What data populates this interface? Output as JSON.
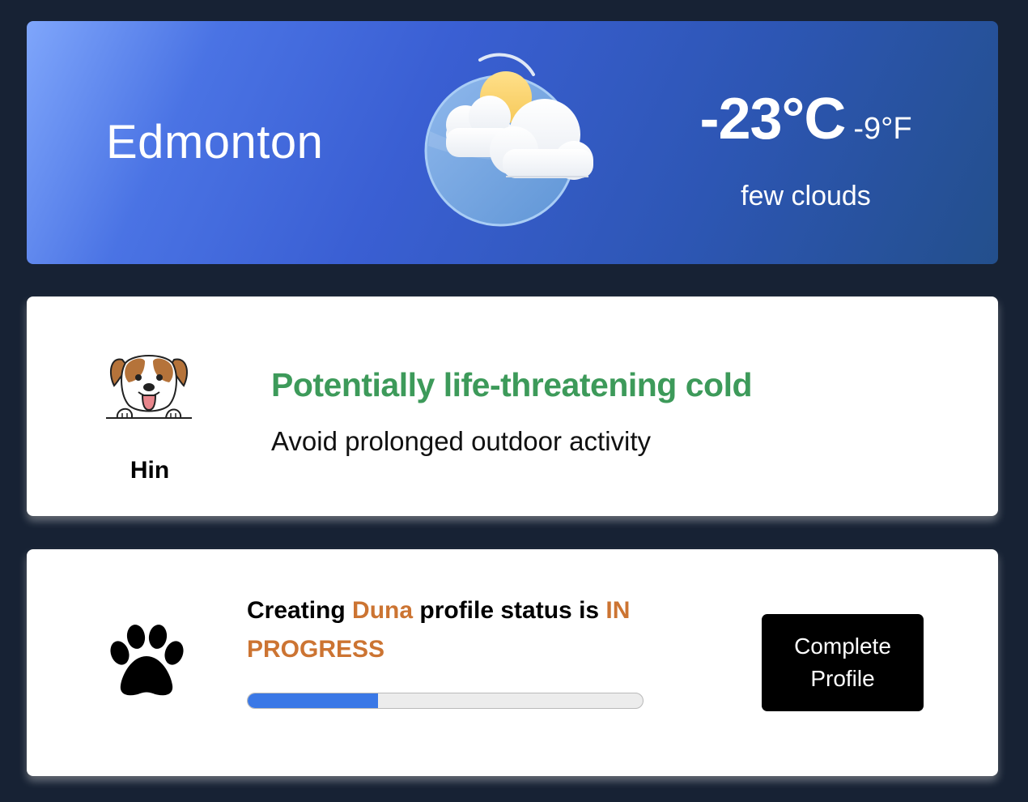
{
  "weather": {
    "city": "Edmonton",
    "temp_c": "-23°C",
    "temp_f": "-9°F",
    "description": "few clouds",
    "icon": "few-clouds-icon"
  },
  "warning": {
    "pet_name": "Hin",
    "pet_icon": "dog-avatar-icon",
    "title": "Potentially life-threatening cold",
    "subtitle": "Avoid prolonged outdoor activity",
    "title_color": "#3d9a5a"
  },
  "profile_status": {
    "icon": "paw-icon",
    "prefix": "Creating ",
    "pet_name": "Duna",
    "middle": " profile status is ",
    "status": "IN PROGRESS",
    "accent_color": "#cc7432",
    "progress_fraction": 0.33,
    "progress_color": "#3a78e6",
    "button_label": "Complete Profile"
  }
}
